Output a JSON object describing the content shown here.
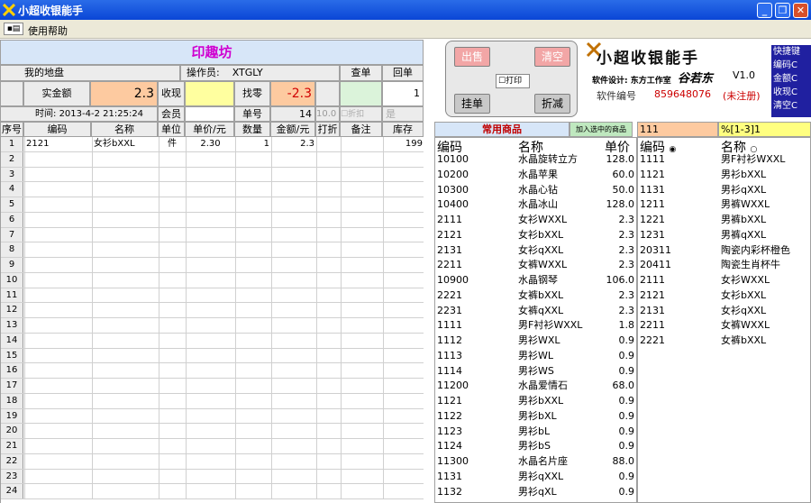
{
  "window": {
    "title": "小超收银能手"
  },
  "menu": {
    "help": "使用帮助"
  },
  "left": {
    "banner": "印趣坊",
    "my_location": "我的地盘",
    "operator_label": "操作员:",
    "operator": "XTGLY",
    "query_btn": "查单",
    "return_btn": "回单",
    "count_value": "1",
    "actual_label": "实金额",
    "actual_value": "2.3",
    "received_label": "收现",
    "change_label": "找零",
    "change_value": "-2.3",
    "time_label": "时间:",
    "time_value": "2013-4-2 21:25:24",
    "member_label": "会员",
    "order_label": "单号",
    "order_value": "14",
    "discount_value": "10.0",
    "discount_check": "折扣",
    "yes_label": "是",
    "columns": [
      "序号",
      "编码",
      "名称",
      "单位",
      "单价/元",
      "数量",
      "金额/元",
      "打折",
      "备注",
      "库存"
    ],
    "rows": [
      {
        "code": "2121",
        "name": "女衫bXXL",
        "unit": "件",
        "price": "2.30",
        "qty": "1",
        "amount": "2.3",
        "stock": "199"
      }
    ],
    "row_numbers": [
      "1",
      "2",
      "3",
      "4",
      "5",
      "6",
      "7",
      "8",
      "9",
      "10",
      "11",
      "12",
      "13",
      "14",
      "15",
      "16",
      "17",
      "18",
      "19",
      "20",
      "21",
      "22",
      "23",
      "24"
    ]
  },
  "controls": {
    "sell": "出售",
    "clear": "清空",
    "print": "打印",
    "hold": "挂单",
    "discount": "折减",
    "app_logo": "小超收银能手",
    "design": "软件设计: 东方工作室",
    "designer_sig": "谷若东",
    "version": "V1.0",
    "serial_label": "软件编号",
    "serial": "859648076",
    "reg_status": "(未注册)",
    "shortcuts": [
      "快捷键",
      "编码C",
      "金额C",
      "收现C",
      "清空C"
    ]
  },
  "common": {
    "title": "常用商品",
    "add_btn": "加入选中的商品",
    "search_code": "111",
    "search_pattern": "%[1-3]1",
    "col_code": "编码",
    "col_name": "名称",
    "col_price": "单价",
    "items": [
      [
        "10100",
        "水晶旋转立方",
        "128.0"
      ],
      [
        "10200",
        "水晶苹果",
        "60.0"
      ],
      [
        "10300",
        "水晶心钻",
        "50.0"
      ],
      [
        "10400",
        "水晶冰山",
        "128.0"
      ],
      [
        "2111",
        "女衫WXXL",
        "2.3"
      ],
      [
        "2121",
        "女衫bXXL",
        "2.3"
      ],
      [
        "2131",
        "女衫qXXL",
        "2.3"
      ],
      [
        "2211",
        "女裤WXXL",
        "2.3"
      ],
      [
        "10900",
        "水晶钢琴",
        "106.0"
      ],
      [
        "2221",
        "女裤bXXL",
        "2.3"
      ],
      [
        "2231",
        "女裤qXXL",
        "2.3"
      ],
      [
        "1111",
        "男F衬衫WXXL",
        "1.8"
      ],
      [
        "1112",
        "男衫WXL",
        "0.9"
      ],
      [
        "1113",
        "男衫WL",
        "0.9"
      ],
      [
        "1114",
        "男衫WS",
        "0.9"
      ],
      [
        "11200",
        "水晶爱情石",
        "68.0"
      ],
      [
        "1121",
        "男衫bXXL",
        "0.9"
      ],
      [
        "1122",
        "男衫bXL",
        "0.9"
      ],
      [
        "1123",
        "男衫bL",
        "0.9"
      ],
      [
        "1124",
        "男衫bS",
        "0.9"
      ],
      [
        "11300",
        "水晶名片座",
        "88.0"
      ],
      [
        "1131",
        "男衫qXXL",
        "0.9"
      ],
      [
        "1132",
        "男衫qXL",
        "0.9"
      ]
    ],
    "search_col_code": "编码",
    "search_col_name": "名称",
    "search_items": [
      [
        "1111",
        "男F衬衫WXXL"
      ],
      [
        "1121",
        "男衫bXXL"
      ],
      [
        "1131",
        "男衫qXXL"
      ],
      [
        "1211",
        "男裤WXXL"
      ],
      [
        "1221",
        "男裤bXXL"
      ],
      [
        "1231",
        "男裤qXXL"
      ],
      [
        "20311",
        "陶瓷内彩杯橙色"
      ],
      [
        "20411",
        "陶瓷生肖杯牛"
      ],
      [
        "2111",
        "女衫WXXL"
      ],
      [
        "2121",
        "女衫bXXL"
      ],
      [
        "2131",
        "女衫qXXL"
      ],
      [
        "2211",
        "女裤WXXL"
      ],
      [
        "2221",
        "女裤bXXL"
      ]
    ]
  }
}
